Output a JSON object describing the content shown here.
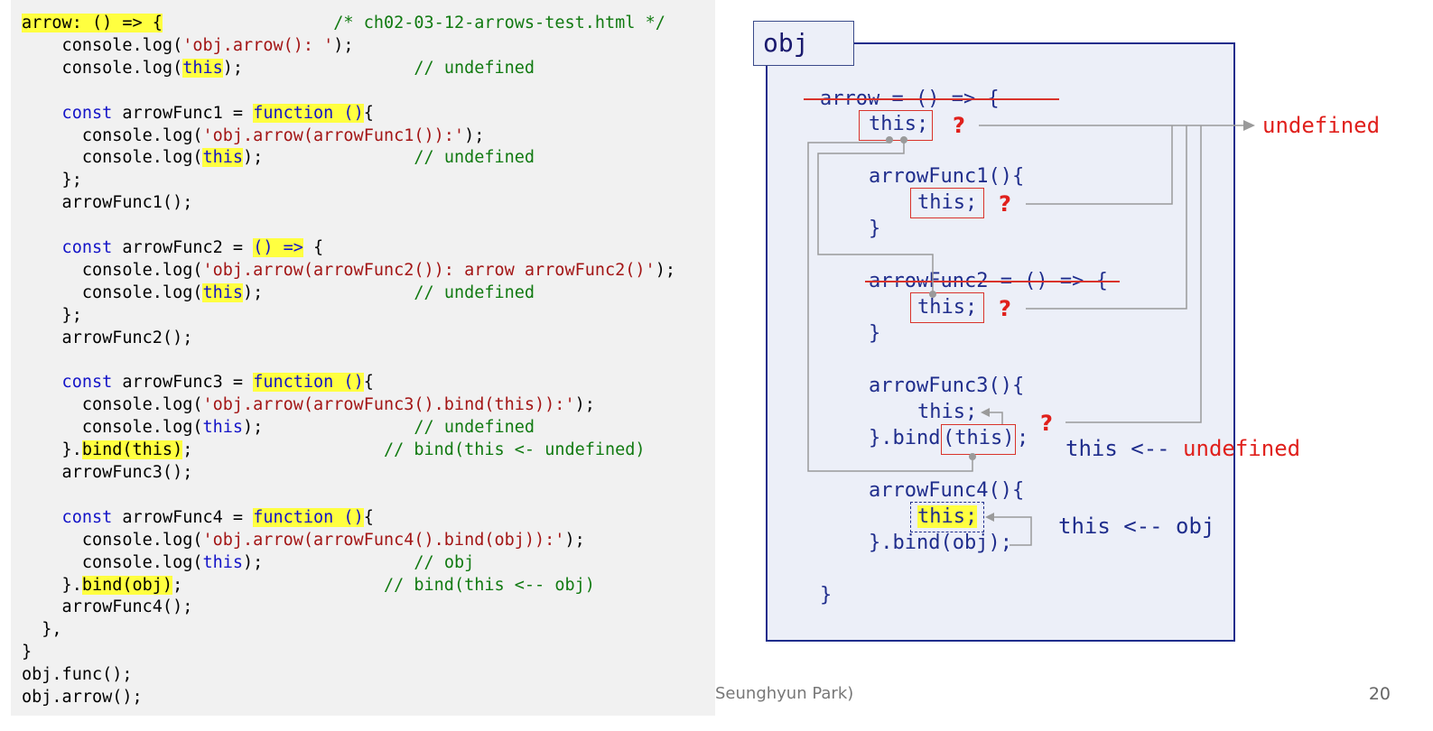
{
  "code": {
    "lines": [
      [
        [
          "hl",
          "arrow: () => {"
        ],
        [
          "plain",
          "                 "
        ],
        [
          "com",
          "/* ch02-03-12-arrows-test.html */"
        ]
      ],
      [
        [
          "plain",
          "    console.log("
        ],
        [
          "str",
          "'obj.arrow(): '"
        ],
        [
          "plain",
          ");"
        ]
      ],
      [
        [
          "plain",
          "    console.log("
        ],
        [
          "hlkw",
          "this"
        ],
        [
          "plain",
          ");                 "
        ],
        [
          "com",
          "// undefined"
        ]
      ],
      [],
      [
        [
          "kw",
          "    const"
        ],
        [
          "plain",
          " arrowFunc1 = "
        ],
        [
          "hlkw",
          "function ()"
        ],
        [
          "plain",
          "{"
        ]
      ],
      [
        [
          "plain",
          "      console.log("
        ],
        [
          "str",
          "'obj.arrow(arrowFunc1()):'"
        ],
        [
          "plain",
          ");"
        ]
      ],
      [
        [
          "plain",
          "      console.log("
        ],
        [
          "hlkw",
          "this"
        ],
        [
          "plain",
          ");               "
        ],
        [
          "com",
          "// undefined"
        ]
      ],
      [
        [
          "plain",
          "    };"
        ]
      ],
      [
        [
          "plain",
          "    arrowFunc1();"
        ]
      ],
      [],
      [
        [
          "kw",
          "    const"
        ],
        [
          "plain",
          " arrowFunc2 = "
        ],
        [
          "hlkw",
          "() =>"
        ],
        [
          "plain",
          " {"
        ]
      ],
      [
        [
          "plain",
          "      console.log("
        ],
        [
          "str",
          "'obj.arrow(arrowFunc2()): arrow arrowFunc2()'"
        ],
        [
          "plain",
          ");"
        ]
      ],
      [
        [
          "plain",
          "      console.log("
        ],
        [
          "hlkw",
          "this"
        ],
        [
          "plain",
          ");               "
        ],
        [
          "com",
          "// undefined"
        ]
      ],
      [
        [
          "plain",
          "    };"
        ]
      ],
      [
        [
          "plain",
          "    arrowFunc2();"
        ]
      ],
      [],
      [
        [
          "kw",
          "    const"
        ],
        [
          "plain",
          " arrowFunc3 = "
        ],
        [
          "hlkw",
          "function ()"
        ],
        [
          "plain",
          "{"
        ]
      ],
      [
        [
          "plain",
          "      console.log("
        ],
        [
          "str",
          "'obj.arrow(arrowFunc3().bind(this)):'"
        ],
        [
          "plain",
          ");"
        ]
      ],
      [
        [
          "plain",
          "      console.log("
        ],
        [
          "kw",
          "this"
        ],
        [
          "plain",
          ");               "
        ],
        [
          "com",
          "// undefined"
        ]
      ],
      [
        [
          "plain",
          "    }."
        ],
        [
          "hl",
          "bind(this)"
        ],
        [
          "plain",
          ";                   "
        ],
        [
          "com",
          "// bind(this <- undefined)"
        ]
      ],
      [
        [
          "plain",
          "    arrowFunc3();"
        ]
      ],
      [],
      [
        [
          "kw",
          "    const"
        ],
        [
          "plain",
          " arrowFunc4 = "
        ],
        [
          "hlkw",
          "function ()"
        ],
        [
          "plain",
          "{"
        ]
      ],
      [
        [
          "plain",
          "      console.log("
        ],
        [
          "str",
          "'obj.arrow(arrowFunc4().bind(obj)):'"
        ],
        [
          "plain",
          ");"
        ]
      ],
      [
        [
          "plain",
          "      console.log("
        ],
        [
          "kw",
          "this"
        ],
        [
          "plain",
          ");               "
        ],
        [
          "com",
          "// obj"
        ]
      ],
      [
        [
          "plain",
          "    }."
        ],
        [
          "hl",
          "bind(obj)"
        ],
        [
          "plain",
          ";                    "
        ],
        [
          "com",
          "// bind(this <-- obj)"
        ]
      ],
      [
        [
          "plain",
          "    arrowFunc4();"
        ]
      ],
      [
        [
          "plain",
          "  },"
        ]
      ],
      [
        [
          "plain",
          "}"
        ]
      ],
      [
        [
          "plain",
          "obj.func();"
        ]
      ],
      [
        [
          "plain",
          "obj.arrow();"
        ]
      ]
    ]
  },
  "diagram": {
    "obj_label": "obj",
    "arrow_decl": "arrow = () => {",
    "this_stmt": "this;",
    "question": "?",
    "undefined_label": "undefined",
    "arrowfunc1_open": "arrowFunc1(){",
    "close_brace": "}",
    "arrowfunc2_decl": "arrowFunc2 = () => {",
    "arrowfunc3_open": "arrowFunc3(){",
    "bind_prefix": "}.bind",
    "bind_this_arg": "(this)",
    "bind_suffix": ";",
    "this_arrow": "this <-- ",
    "this_arrow_undefined": "undefined",
    "arrowfunc4_open": "arrowFunc4(){",
    "bind_obj": "}.bind(obj);",
    "this_arrow_obj": "this <-- obj",
    "outer_close": "}"
  },
  "footer": {
    "author": "Seunghyun Park)",
    "page_number": "20"
  },
  "colors": {
    "keyword": "#1414c8",
    "string": "#a31515",
    "comment": "#117a11",
    "highlight": "#ffff40",
    "diagram_text": "#1f2d8c",
    "red": "#e0201c",
    "connector": "#9a9a9a"
  }
}
